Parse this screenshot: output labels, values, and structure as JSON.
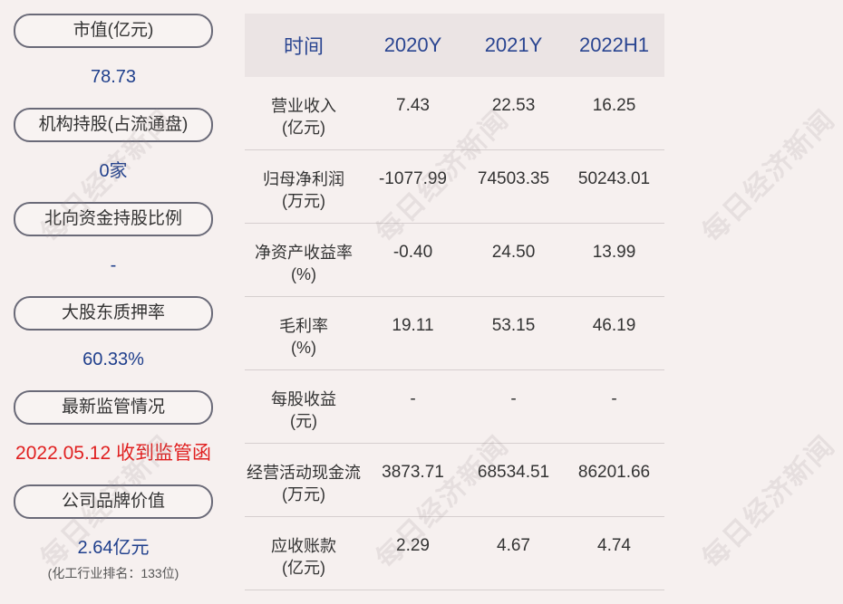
{
  "left_metrics": [
    {
      "label": "市值(亿元)",
      "value": "78.73"
    },
    {
      "label": "机构持股(占流通盘)",
      "value": "0家"
    },
    {
      "label": "北向资金持股比例",
      "value": "-"
    },
    {
      "label": "大股东质押率",
      "value": "60.33%"
    },
    {
      "label": "最新监管情况",
      "value": "2022.05.12 收到监管函"
    },
    {
      "label": "公司品牌价值",
      "value": "2.64亿元",
      "note": "(化工行业排名：133位)"
    }
  ],
  "table": {
    "headers": [
      "时间",
      "2020Y",
      "2021Y",
      "2022H1"
    ],
    "rows": [
      {
        "label1": "营业收入",
        "label2": "(亿元)",
        "values": [
          "7.43",
          "22.53",
          "16.25"
        ]
      },
      {
        "label1": "归母净利润",
        "label2": "(万元)",
        "values": [
          "-1077.99",
          "74503.35",
          "50243.01"
        ]
      },
      {
        "label1": "净资产收益率",
        "label2": "(%)",
        "values": [
          "-0.40",
          "24.50",
          "13.99"
        ]
      },
      {
        "label1": "毛利率",
        "label2": "(%)",
        "values": [
          "19.11",
          "53.15",
          "46.19"
        ]
      },
      {
        "label1": "每股收益",
        "label2": "(元)",
        "values": [
          "-",
          "-",
          "-"
        ]
      },
      {
        "label1": "经营活动现金流",
        "label2": "(万元)",
        "values": [
          "3873.71",
          "68534.51",
          "86201.66"
        ]
      },
      {
        "label1": "应收账款",
        "label2": "(亿元)",
        "values": [
          "2.29",
          "4.67",
          "4.74"
        ]
      }
    ]
  },
  "watermark": "每日经济新闻",
  "colors": {
    "background": "#f6f0ef",
    "value_blue": "#1f3f8c",
    "header_blue": "#2a4591",
    "alert_red": "#e02020"
  }
}
